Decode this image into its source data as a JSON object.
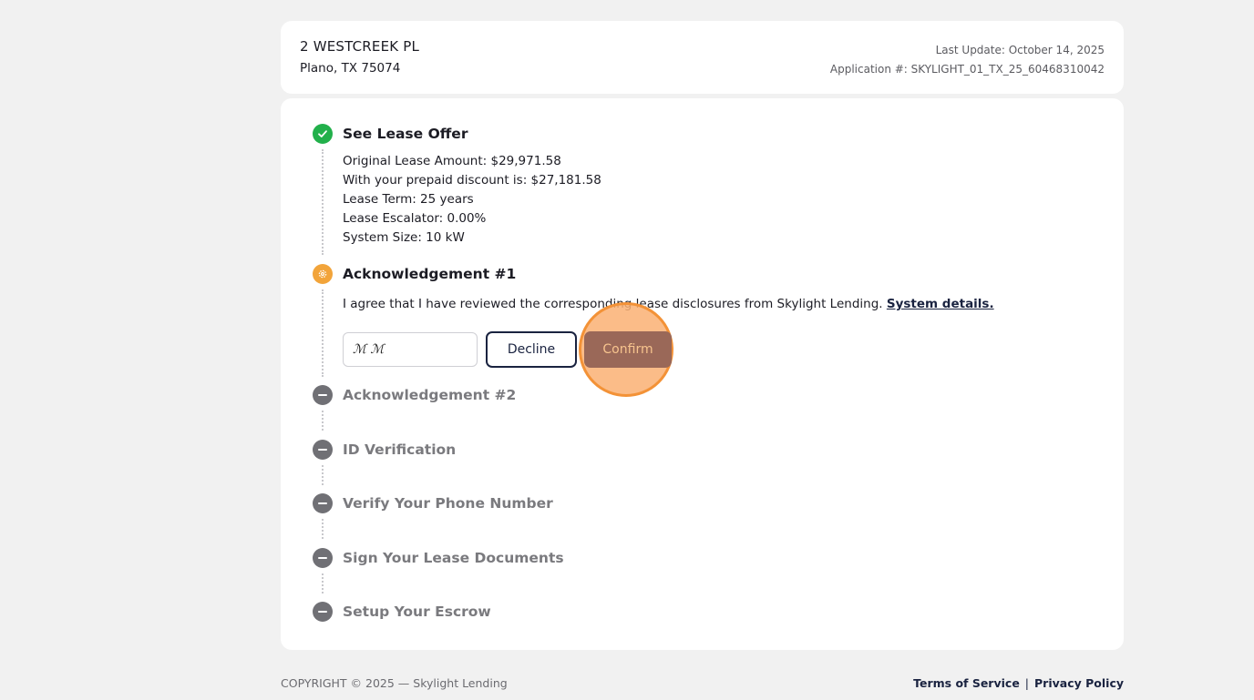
{
  "header": {
    "address_line1": "2 WESTCREEK PL",
    "address_line2": "Plano, TX 75074",
    "last_update": "Last Update: October 14, 2025",
    "application_number": "Application #: SKYLIGHT_01_TX_25_60468310042"
  },
  "steps": [
    {
      "title": "See Lease Offer",
      "status": "complete",
      "icon": "check-icon",
      "details": [
        "Original Lease Amount: $29,971.58",
        "With your prepaid discount is: $27,181.58",
        "Lease Term: 25 years",
        "Lease Escalator: 0.00%",
        "System Size: 10 kW"
      ]
    },
    {
      "title": "Acknowledgement #1",
      "status": "active",
      "icon": "gear-icon",
      "text": "I agree that I have reviewed the corresponding lease disclosures from Skylight Lending.",
      "link": "System details.",
      "signature_value": "ℳ ℳ",
      "decline_label": "Decline",
      "confirm_label": "Confirm"
    },
    {
      "title": "Acknowledgement #2",
      "status": "pending",
      "icon": "minus-icon"
    },
    {
      "title": "ID Verification",
      "status": "pending",
      "icon": "minus-icon"
    },
    {
      "title": "Verify Your Phone Number",
      "status": "pending",
      "icon": "minus-icon"
    },
    {
      "title": "Sign Your Lease Documents",
      "status": "pending",
      "icon": "minus-icon"
    },
    {
      "title": "Setup Your Escrow",
      "status": "pending",
      "icon": "minus-icon"
    }
  ],
  "colors": {
    "complete": "#22b04b",
    "active": "#f2a43a",
    "pending": "#707075",
    "navy": "#1a2340",
    "confirm_bg": "#9a6858",
    "highlight": "#f39237"
  },
  "footer": {
    "copyright": "COPYRIGHT © 2025 — Skylight Lending",
    "terms": "Terms of Service",
    "privacy": "Privacy Policy",
    "separator": "|"
  }
}
